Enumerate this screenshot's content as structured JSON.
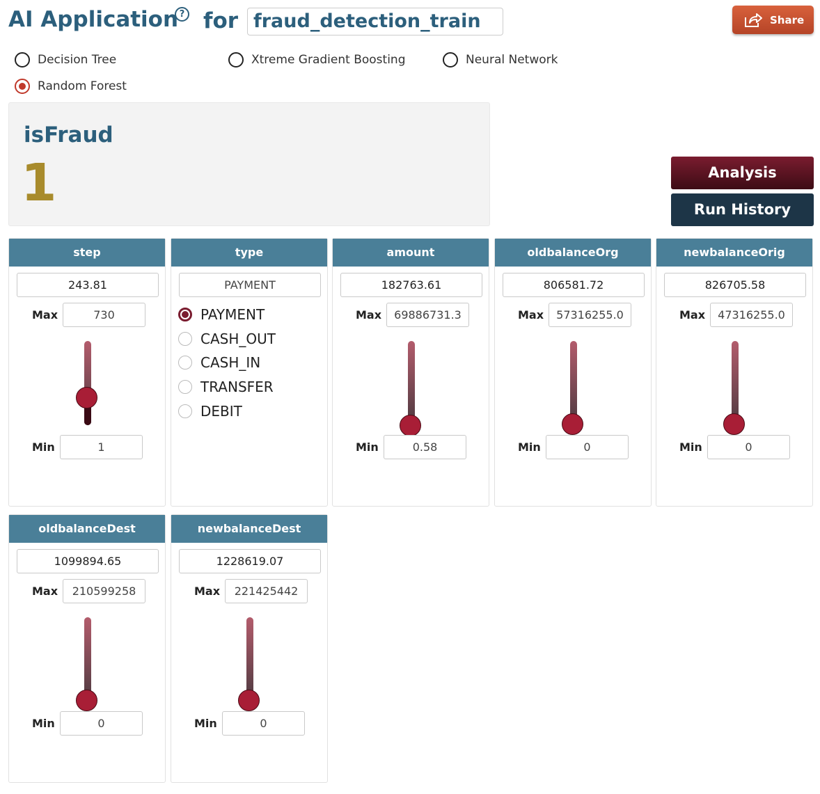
{
  "header": {
    "title": "AI Application",
    "help_symbol": "?",
    "for_label": "for",
    "dataset": "fraud_detection_train",
    "share_label": "Share"
  },
  "models": [
    {
      "label": "Decision Tree",
      "selected": false
    },
    {
      "label": "Xtreme Gradient Boosting",
      "selected": false
    },
    {
      "label": "Neural Network",
      "selected": false
    },
    {
      "label": "Random Forest",
      "selected": true
    }
  ],
  "result": {
    "label": "isFraud",
    "value": "1"
  },
  "buttons": {
    "analysis": "Analysis",
    "run_history": "Run History"
  },
  "colors": {
    "header_teal": "#4a7f98",
    "title_blue": "#2c5f7c",
    "result_gold": "#a88b2c",
    "slider_thumb": "#a81e36",
    "share_orange": "#c9512f"
  },
  "features": [
    {
      "name": "step",
      "value": "243.81",
      "max_label": "Max",
      "max": "730",
      "min_label": "Min",
      "min": "1",
      "slider_fraction": 0.33
    },
    {
      "name": "type",
      "value": "PAYMENT",
      "options": [
        "PAYMENT",
        "CASH_OUT",
        "CASH_IN",
        "TRANSFER",
        "DEBIT"
      ],
      "selected": "PAYMENT"
    },
    {
      "name": "amount",
      "value": "182763.61",
      "max_label": "Max",
      "max": "69886731.3",
      "min_label": "Min",
      "min": "0.58",
      "slider_fraction": 0.0
    },
    {
      "name": "oldbalanceOrg",
      "value": "806581.72",
      "max_label": "Max",
      "max": "57316255.0",
      "min_label": "Min",
      "min": "0",
      "slider_fraction": 0.01
    },
    {
      "name": "newbalanceOrig",
      "value": "826705.58",
      "max_label": "Max",
      "max": "47316255.0",
      "min_label": "Min",
      "min": "0",
      "slider_fraction": 0.01
    },
    {
      "name": "oldbalanceDest",
      "value": "1099894.65",
      "max_label": "Max",
      "max": "210599258",
      "min_label": "Min",
      "min": "0",
      "slider_fraction": 0.01
    },
    {
      "name": "newbalanceDest",
      "value": "1228619.07",
      "max_label": "Max",
      "max": "221425442",
      "min_label": "Min",
      "min": "0",
      "slider_fraction": 0.01
    }
  ]
}
